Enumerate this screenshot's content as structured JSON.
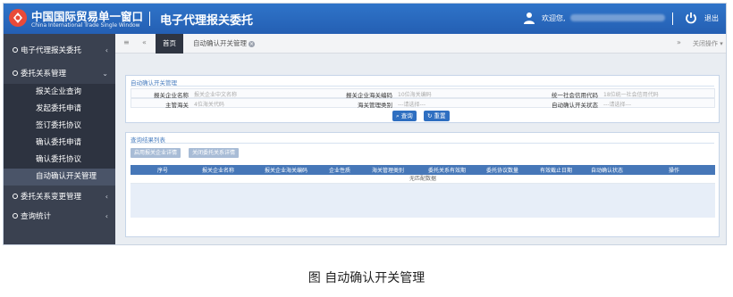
{
  "header": {
    "brand_cn": "中国国际贸易单一窗口",
    "brand_en": "China International Trade Single Window",
    "app_title": "电子代理报关委托",
    "welcome": "欢迎您,",
    "logout": "退出"
  },
  "sidebar": {
    "top": "电子代理报关委托",
    "group1": "委托关系管理",
    "items": [
      "报关企业查询",
      "发起委托申请",
      "签订委托协议",
      "确认委托申请",
      "确认委托协议",
      "自动确认开关管理"
    ],
    "group2": "委托关系变更管理",
    "group3": "查询统计"
  },
  "tabbar": {
    "home": "首页",
    "current": "自动确认开关管理",
    "close_ops": "关闭操作"
  },
  "search_panel": {
    "title": "自动确认开关管理",
    "fields": [
      {
        "label": "报关企业名称",
        "placeholder": "报关企业中文名称"
      },
      {
        "label": "报关企业海关编码",
        "placeholder": "10位海关编码"
      },
      {
        "label": "统一社会信用代码",
        "placeholder": "18位统一社会信用代码"
      },
      {
        "label": "主管海关",
        "placeholder": "4位海关代码"
      },
      {
        "label": "海关管理类别",
        "placeholder": "---请选择---"
      },
      {
        "label": "自动确认开关状态",
        "placeholder": "---请选择---"
      }
    ],
    "query_btn": "查询",
    "reset_btn": "重置"
  },
  "results": {
    "title": "查询结果列表",
    "btn_open": "启用报关企业详情",
    "btn_close": "关闭委托关系详情",
    "columns": [
      "序号",
      "报关企业名称",
      "报关企业海关编码",
      "企业性质",
      "海关管理类别",
      "委托关系有效期",
      "委托协议数量",
      "有效截止日期",
      "自动确认状态",
      "操作"
    ],
    "empty": "无匹配数据"
  },
  "caption": "图  自动确认开关管理",
  "colors": {
    "header": "#2f74c9",
    "sidebar": "#3a4150",
    "table_head": "#4677b8"
  }
}
